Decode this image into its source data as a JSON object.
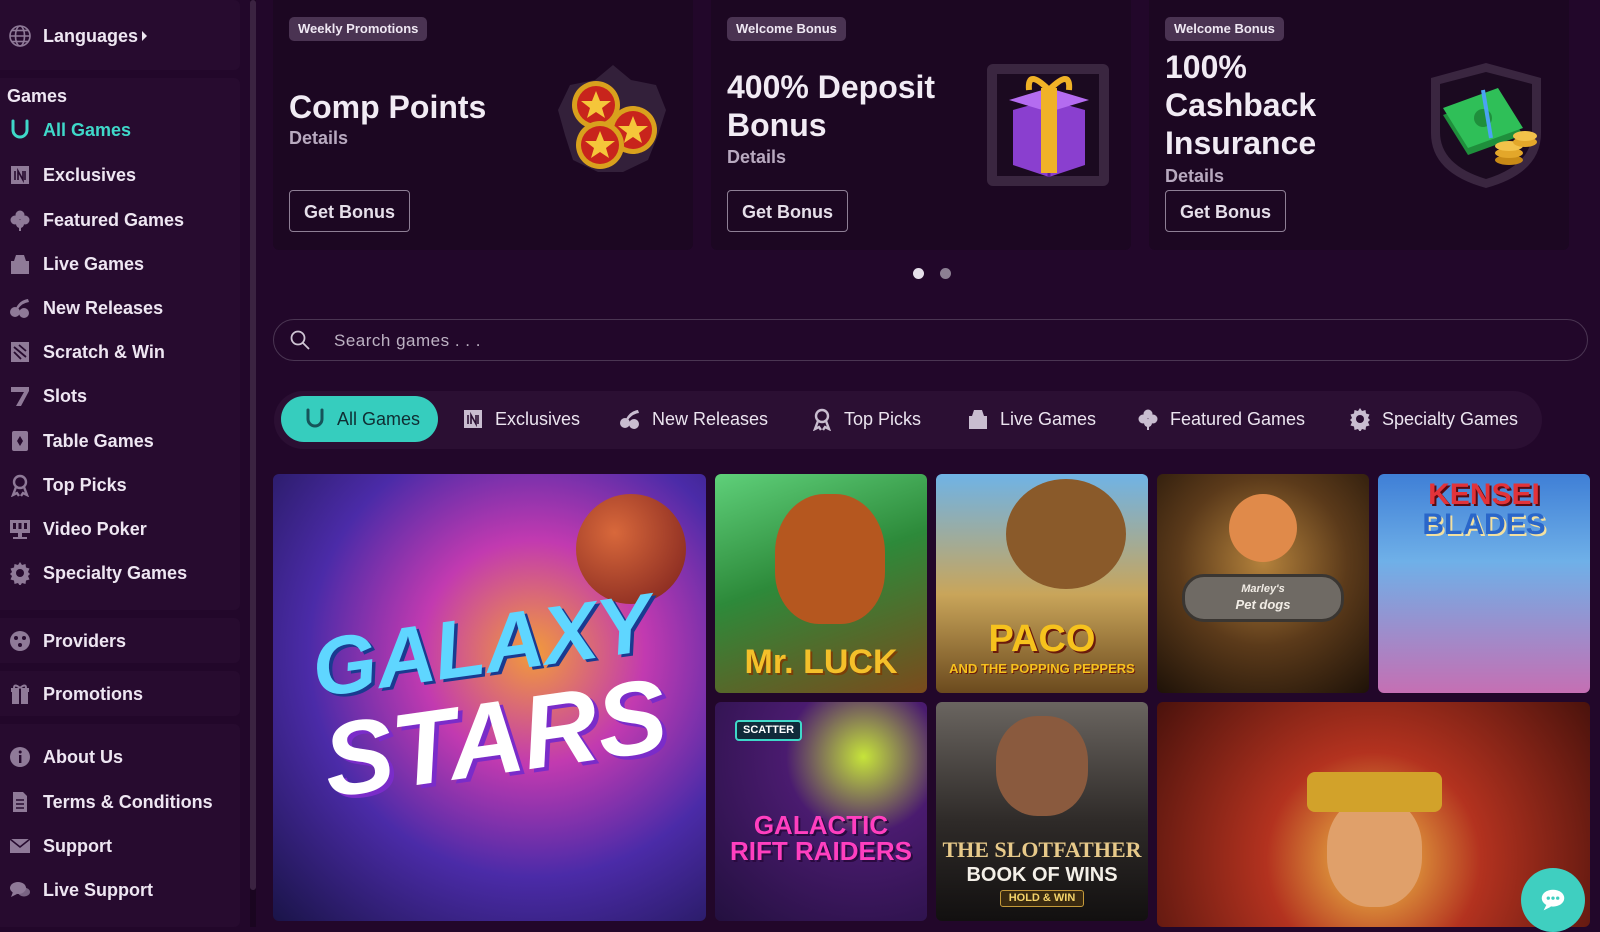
{
  "sidebar": {
    "languages": "Languages",
    "games_heading": "Games",
    "items": [
      {
        "label": "All Games",
        "icon": "horseshoe-icon"
      },
      {
        "label": "Exclusives",
        "icon": "exclusives-icon"
      },
      {
        "label": "Featured Games",
        "icon": "clover-icon"
      },
      {
        "label": "Live Games",
        "icon": "live-games-icon"
      },
      {
        "label": "New Releases",
        "icon": "cherries-icon"
      },
      {
        "label": "Scratch & Win",
        "icon": "scratch-ticket-icon"
      },
      {
        "label": "Slots",
        "icon": "slot-seven-icon"
      },
      {
        "label": "Table Games",
        "icon": "playing-card-icon"
      },
      {
        "label": "Top Picks",
        "icon": "award-ribbon-icon"
      },
      {
        "label": "Video Poker",
        "icon": "video-poker-icon"
      },
      {
        "label": "Specialty Games",
        "icon": "gear-icon"
      }
    ],
    "providers": "Providers",
    "promotions": "Promotions",
    "info_items": [
      {
        "label": "About Us",
        "icon": "info-icon"
      },
      {
        "label": "Terms & Conditions",
        "icon": "document-icon"
      },
      {
        "label": "Support",
        "icon": "envelope-icon"
      },
      {
        "label": "Live Support",
        "icon": "chat-bubbles-icon"
      }
    ]
  },
  "promos": [
    {
      "tag": "Weekly Promotions",
      "title_lines": [
        "Comp Points"
      ],
      "details": "Details",
      "button": "Get Bonus",
      "art": "coins-icon"
    },
    {
      "tag": "Welcome Bonus",
      "title_lines": [
        "400% Deposit",
        "Bonus"
      ],
      "details": "Details",
      "button": "Get Bonus",
      "art": "gift-box-icon"
    },
    {
      "tag": "Welcome Bonus",
      "title_lines": [
        "100%",
        "Cashback",
        "Insurance"
      ],
      "details": "Details",
      "button": "Get Bonus",
      "art": "cash-stack-icon"
    }
  ],
  "carousel": {
    "pages": 2,
    "current": 1
  },
  "search": {
    "placeholder": "Search games . . ."
  },
  "tabs": [
    {
      "label": "All Games",
      "icon": "horseshoe-icon",
      "active": true
    },
    {
      "label": "Exclusives",
      "icon": "exclusives-icon",
      "active": false
    },
    {
      "label": "New Releases",
      "icon": "cherries-icon",
      "active": false
    },
    {
      "label": "Top Picks",
      "icon": "award-ribbon-icon",
      "active": false
    },
    {
      "label": "Live Games",
      "icon": "live-games-icon",
      "active": false
    },
    {
      "label": "Featured Games",
      "icon": "clover-icon",
      "active": false
    },
    {
      "label": "Specialty Games",
      "icon": "gear-icon",
      "active": false
    }
  ],
  "games": [
    {
      "line1": "GALAXY",
      "line2": "STARS"
    },
    {
      "line1": "Mr. LUCK",
      "line2": ""
    },
    {
      "line1": "PACO",
      "line2": "AND THE POPPING PEPPERS"
    },
    {
      "line1": "Marley's",
      "line2": "Pet dogs"
    },
    {
      "line1": "KENSEI",
      "line2": "BLADES"
    },
    {
      "line1": "SCATTER",
      "line2": "GALACTIC RIFT RAIDERS"
    },
    {
      "line1": "THE SLOTFATHER",
      "line2": "BOOK OF WINS",
      "line3": "HOLD & WIN"
    },
    {
      "line1": "",
      "line2": ""
    }
  ],
  "colors": {
    "accent": "#3fd8c9",
    "background": "#22072a",
    "card": "#1c0722"
  }
}
